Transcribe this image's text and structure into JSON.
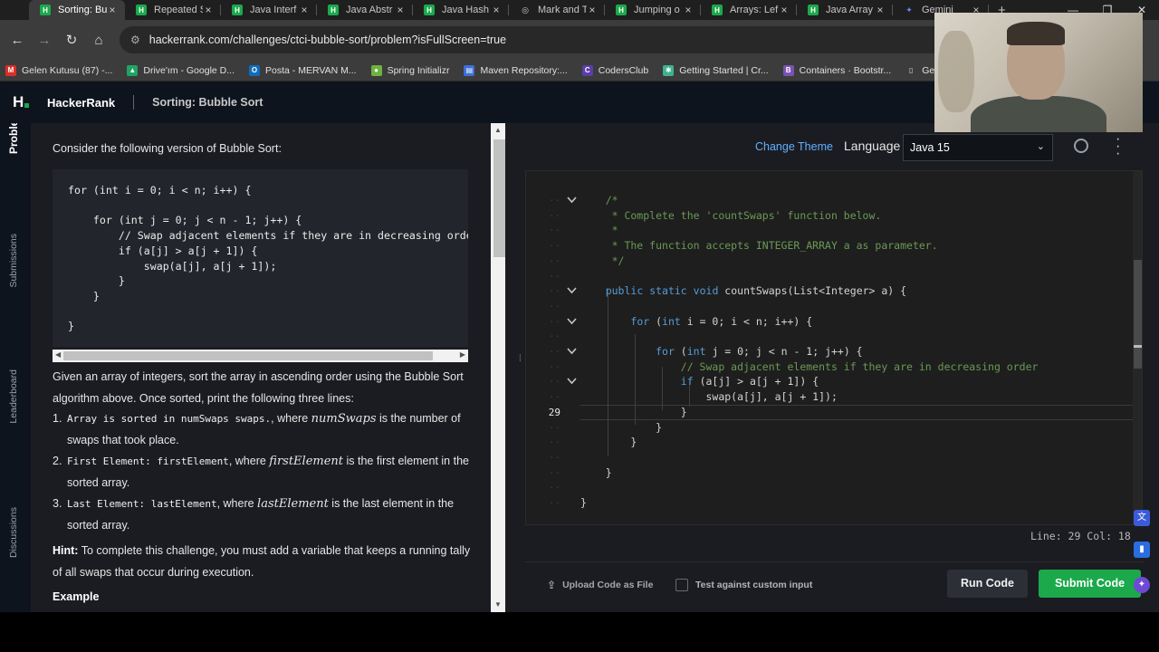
{
  "browser": {
    "tabs": [
      {
        "label": "Sorting: Bu",
        "active": true,
        "favicon": "H",
        "color": "#1ba94c"
      },
      {
        "label": "Repeated S",
        "active": false,
        "favicon": "H",
        "color": "#1ba94c"
      },
      {
        "label": "Java Interf",
        "active": false,
        "favicon": "H",
        "color": "#1ba94c"
      },
      {
        "label": "Java Abstr",
        "active": false,
        "favicon": "H",
        "color": "#1ba94c"
      },
      {
        "label": "Java Hash",
        "active": false,
        "favicon": "H",
        "color": "#1ba94c"
      },
      {
        "label": "Mark and T",
        "active": false,
        "favicon": "globe",
        "color": "#8a8a8a"
      },
      {
        "label": "Jumping o",
        "active": false,
        "favicon": "H",
        "color": "#1ba94c"
      },
      {
        "label": "Arrays: Lef",
        "active": false,
        "favicon": "H",
        "color": "#1ba94c"
      },
      {
        "label": "Java Array",
        "active": false,
        "favicon": "H",
        "color": "#1ba94c"
      },
      {
        "label": "Gemini",
        "active": false,
        "favicon": "gemini",
        "color": "#5b8def"
      }
    ],
    "new_tab": "+",
    "url": "hackerrank.com/challenges/ctci-bubble-sort/problem?isFullScreen=true",
    "bookmarks": [
      {
        "label": "Gelen Kutusu (87) -...",
        "icon": "gmail-icon",
        "color": "#d93025",
        "glyph": "M"
      },
      {
        "label": "Drive'ım - Google D...",
        "icon": "drive-icon",
        "color": "#1fa463",
        "glyph": "▲"
      },
      {
        "label": "Posta - MERVAN M...",
        "icon": "outlook-icon",
        "color": "#0f6cbd",
        "glyph": "O"
      },
      {
        "label": "Spring Initializr",
        "icon": "spring-icon",
        "color": "#6db33f",
        "glyph": "●"
      },
      {
        "label": "Maven Repository:...",
        "icon": "maven-icon",
        "color": "#3d6fd6",
        "glyph": "▤"
      },
      {
        "label": "CodersClub",
        "icon": "coders-icon",
        "color": "#5b3ea6",
        "glyph": "C"
      },
      {
        "label": "Getting Started | Cr...",
        "icon": "chakra-icon",
        "color": "#3fb28f",
        "glyph": "✱"
      },
      {
        "label": "Containers · Bootstr...",
        "icon": "bootstrap-icon",
        "color": "#7952b3",
        "glyph": "B"
      },
      {
        "label": "Getting Started | A",
        "icon": "doc-icon",
        "color": "#e0e0e0",
        "glyph": "▯"
      }
    ]
  },
  "header": {
    "brand": "HackerRank",
    "title": "Sorting: Bubble Sort"
  },
  "sidebar": {
    "items": [
      {
        "label": "Problem",
        "active": true
      },
      {
        "label": "Submissions",
        "active": false
      },
      {
        "label": "Leaderboard",
        "active": false
      },
      {
        "label": "Discussions",
        "active": false
      }
    ]
  },
  "problem": {
    "intro": "Consider the following version of Bubble Sort:",
    "snippet": "for (int i = 0; i < n; i++) {\n\n    for (int j = 0; j < n - 1; j++) {\n        // Swap adjacent elements if they are in decreasing order\n        if (a[j] > a[j + 1]) {\n            swap(a[j], a[j + 1]);\n        }\n    }\n\n}",
    "para1": "Given an array of integers, sort the array in ascending order using the Bubble Sort algorithm above. Once sorted, print the following three lines:",
    "list": [
      {
        "num": "1.",
        "code": "Array is sorted in numSwaps swaps.",
        "mid": ", where ",
        "var": "numSwaps",
        "rest": " is the number of swaps that took place."
      },
      {
        "num": "2.",
        "code": "First Element: firstElement",
        "mid": ", where ",
        "var": "firstElement",
        "rest": " is the first element in the sorted array."
      },
      {
        "num": "3.",
        "code": "Last Element: lastElement",
        "mid": ", where ",
        "var": "lastElement",
        "rest": " is the last element in the sorted array."
      }
    ],
    "hint_label": "Hint:",
    "hint_text": " To complete this challenge, you must add a variable that keeps a running tally of all swaps that occur during execution.",
    "example_heading": "Example"
  },
  "editor": {
    "change_theme": "Change Theme",
    "language_label": "Language",
    "language_value": "Java 15",
    "current_line_number": "29",
    "code_lines": [
      {
        "t": "    /*",
        "c": "cm",
        "fold": true
      },
      {
        "t": "     * Complete the 'countSwaps' function below.",
        "c": "cm"
      },
      {
        "t": "     *",
        "c": "cm"
      },
      {
        "t": "     * The function accepts INTEGER_ARRAY a as parameter.",
        "c": "cm"
      },
      {
        "t": "     */",
        "c": "cm"
      },
      {
        "t": "",
        "c": ""
      },
      {
        "t": "    public static void countSwaps(List<Integer> a) {",
        "c": "sig",
        "fold": true
      },
      {
        "t": "",
        "c": ""
      },
      {
        "t": "        for (int i = 0; i < n; i++) {",
        "c": "for",
        "fold": true
      },
      {
        "t": "",
        "c": ""
      },
      {
        "t": "            for (int j = 0; j < n - 1; j++) {",
        "c": "for",
        "fold": true
      },
      {
        "t": "                // Swap adjacent elements if they are in decreasing order",
        "c": "cm"
      },
      {
        "t": "                if (a[j] > a[j + 1]) {",
        "c": "if",
        "fold": true
      },
      {
        "t": "                    swap(a[j], a[j + 1]);",
        "c": ""
      },
      {
        "t": "                }",
        "c": "",
        "current": true
      },
      {
        "t": "            }",
        "c": ""
      },
      {
        "t": "        }",
        "c": ""
      },
      {
        "t": "",
        "c": ""
      },
      {
        "t": "    }",
        "c": ""
      },
      {
        "t": "",
        "c": ""
      },
      {
        "t": "}",
        "c": ""
      }
    ],
    "status": "Line: 29 Col: 18"
  },
  "actions": {
    "upload": "Upload Code as File",
    "custom_input": "Test against custom input",
    "run": "Run Code",
    "submit": "Submit Code"
  }
}
